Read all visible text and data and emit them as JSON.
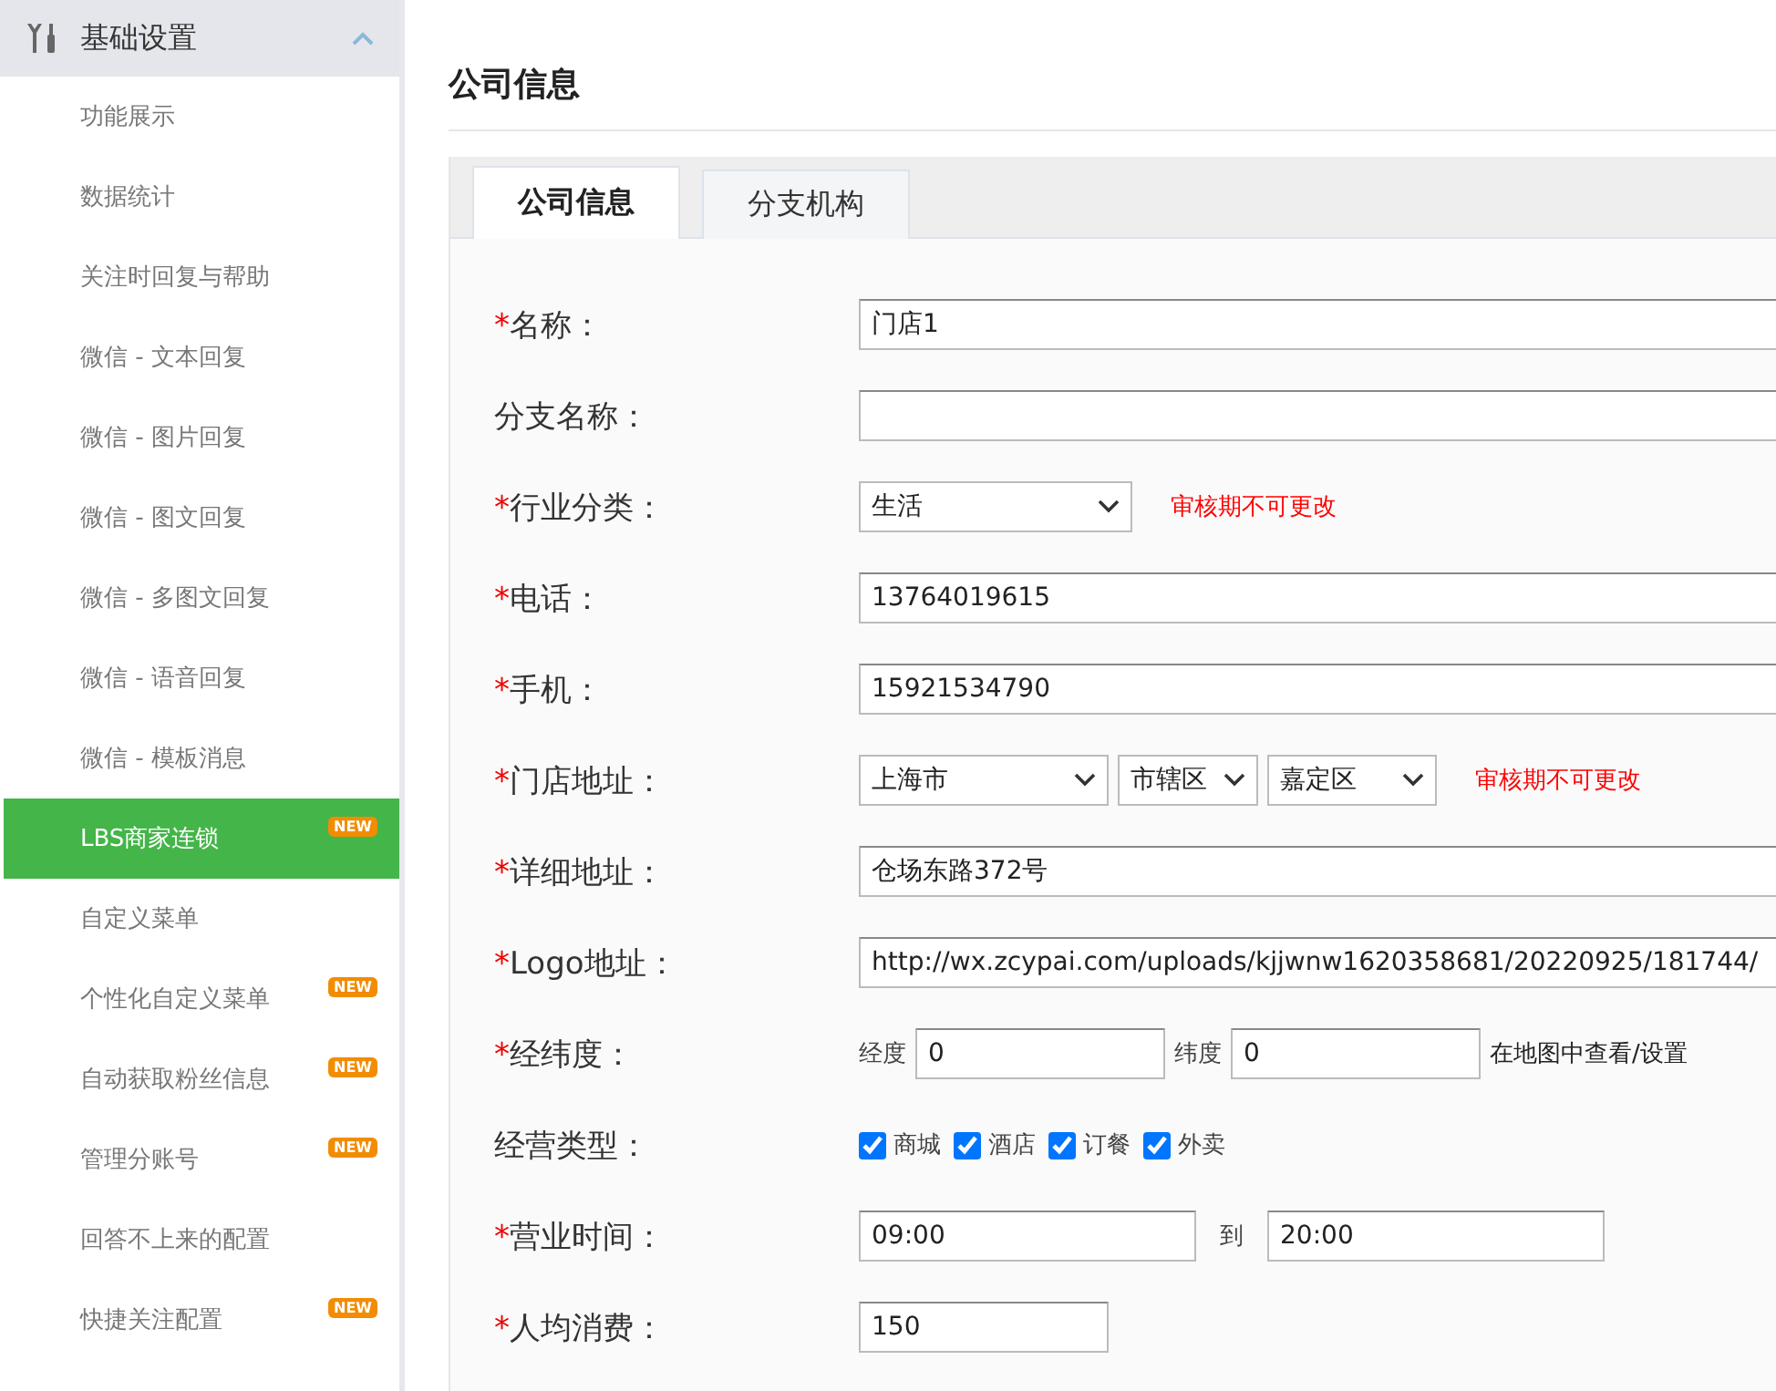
{
  "sidebar": {
    "group": {
      "title": "基础设置",
      "expanded": true
    },
    "items": [
      {
        "label": "功能展示",
        "selected": false
      },
      {
        "label": "数据统计",
        "selected": false
      },
      {
        "label": "关注时回复与帮助",
        "selected": false
      },
      {
        "label": "微信 - 文本回复",
        "selected": false
      },
      {
        "label": "微信 - 图片回复",
        "selected": false
      },
      {
        "label": "微信 - 图文回复",
        "selected": false
      },
      {
        "label": "微信 - 多图文回复",
        "selected": false
      },
      {
        "label": "微信 - 语音回复",
        "selected": false
      },
      {
        "label": "微信 - 模板消息",
        "selected": false
      },
      {
        "label": "LBS商家连锁",
        "selected": true,
        "badge": "NEW"
      },
      {
        "label": "自定义菜单",
        "selected": false
      },
      {
        "label": "个性化自定义菜单",
        "selected": false,
        "badge": "NEW"
      },
      {
        "label": "自动获取粉丝信息",
        "selected": false,
        "badge": "NEW"
      },
      {
        "label": "管理分账号",
        "selected": false,
        "badge": "NEW"
      },
      {
        "label": "回答不上来的配置",
        "selected": false
      },
      {
        "label": "快捷关注配置",
        "selected": false,
        "badge": "NEW"
      }
    ]
  },
  "page_title": "公司信息",
  "tabs": [
    {
      "label": "公司信息",
      "selected": true
    },
    {
      "label": "分支机构",
      "selected": false
    }
  ],
  "form": [
    {
      "kind": "text",
      "required_mark": "*",
      "label": "名称：",
      "value": "门店1"
    },
    {
      "kind": "text",
      "label": "分支名称："
    },
    {
      "kind": "select",
      "required_mark": "*",
      "label": "行业分类：",
      "selects": [
        "生活"
      ],
      "note": "审核期不可更改"
    },
    {
      "kind": "text",
      "required_mark": "*",
      "label": "电话：",
      "value": "13764019615"
    },
    {
      "kind": "text",
      "required_mark": "*",
      "label": "手机：",
      "value": "15921534790"
    },
    {
      "kind": "address",
      "required_mark": "*",
      "label": "门店地址：",
      "selects": [
        "上海市",
        "市辖区",
        "嘉定区"
      ],
      "note": "审核期不可更改"
    },
    {
      "kind": "text",
      "required_mark": "*",
      "label": "详细地址：",
      "value": "仓场东路372号"
    },
    {
      "kind": "text",
      "required_mark": "*",
      "label": "Logo地址：",
      "value": "http://wx.zcypai.com/uploads/kjjwnw1620358681/20220925/181744/"
    },
    {
      "kind": "latlng",
      "required_mark": "*",
      "label": "经纬度：",
      "lng_label": "经度",
      "lng": "0",
      "lat_label": "纬度",
      "lat": "0",
      "link": "在地图中查看/设置"
    },
    {
      "kind": "checks",
      "label": "经营类型：",
      "options": [
        {
          "label": "商城",
          "checked": true
        },
        {
          "label": "酒店",
          "checked": true
        },
        {
          "label": "订餐",
          "checked": true
        },
        {
          "label": "外卖",
          "checked": true
        }
      ]
    },
    {
      "kind": "time",
      "required_mark": "*",
      "label": "营业时间：",
      "from": "09:00",
      "sep": "到",
      "to": "20:00"
    },
    {
      "kind": "short",
      "required_mark": "*",
      "label": "人均消费：",
      "value": "150"
    }
  ]
}
